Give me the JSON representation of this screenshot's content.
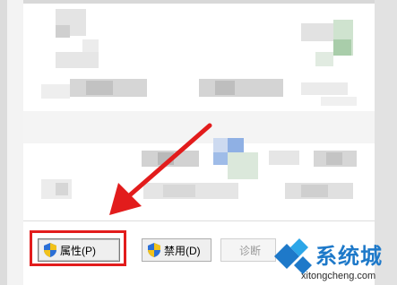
{
  "buttons": {
    "properties": "属性(P)",
    "disable": "禁用(D)",
    "diagnose": "诊断"
  },
  "watermark": {
    "site_name": "系统城",
    "url": "xitongcheng.com"
  },
  "colors": {
    "highlight": "#e21c1c",
    "watermark_blue": "#1e79c9"
  }
}
